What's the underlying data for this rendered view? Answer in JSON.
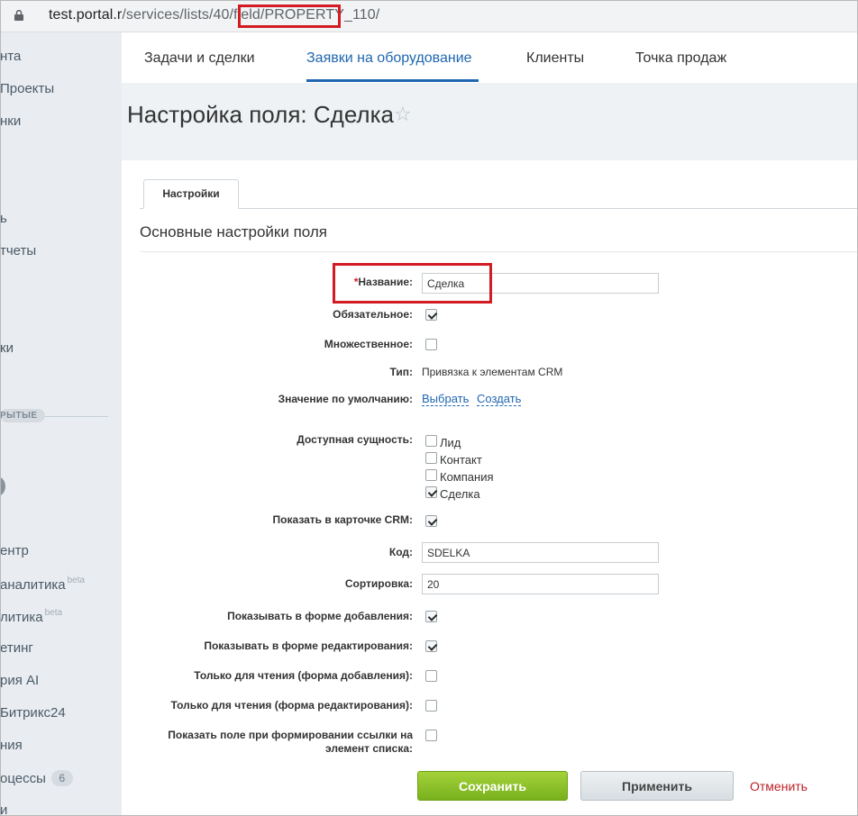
{
  "browser": {
    "url_host": "test.portal.r",
    "url_sep": "/",
    "url_path": "services/lists/40/field/",
    "url_highlight": "PROPERTY_110/"
  },
  "sidebar": {
    "items": [
      {
        "label": "нта"
      },
      {
        "label": "Проекты"
      },
      {
        "label": "нки"
      },
      {
        "label": "ь"
      },
      {
        "label": "тчеты"
      },
      {
        "label": "ки"
      },
      {
        "label": "ентр"
      },
      {
        "label": "аналитика",
        "sup": "beta"
      },
      {
        "label": "литика",
        "sup": "beta"
      },
      {
        "label": "етинг"
      },
      {
        "label": "рия AI"
      },
      {
        "label": "Битрикс24"
      },
      {
        "label": "ния"
      },
      {
        "label": "оцессы",
        "badge": "6"
      },
      {
        "label": "и"
      }
    ],
    "section_badge": "РЫТЫЕ"
  },
  "topnav": {
    "tabs": [
      {
        "label": "Задачи и сделки"
      },
      {
        "label": "Заявки на оборудование"
      },
      {
        "label": "Клиенты"
      },
      {
        "label": "Точка продаж"
      }
    ]
  },
  "page": {
    "title": "Настройка поля: Сделка",
    "star": "☆"
  },
  "form": {
    "tab_label": "Настройки",
    "section_title": "Основные настройки поля",
    "fields": {
      "name": {
        "required_mark": "*",
        "label": "Название:",
        "value": "Сделка"
      },
      "mandatory": {
        "label": "Обязательное:",
        "checked": true
      },
      "multiple": {
        "label": "Множественное:",
        "checked": false
      },
      "type": {
        "label": "Тип:",
        "value": "Привязка к элементам CRM"
      },
      "default_value": {
        "label": "Значение по умолчанию:",
        "link_select": "Выбрать",
        "link_create": "Создать"
      },
      "entities": {
        "label": "Доступная сущность:",
        "options": [
          {
            "label": "Лид",
            "checked": false
          },
          {
            "label": "Контакт",
            "checked": false
          },
          {
            "label": "Компания",
            "checked": false
          },
          {
            "label": "Сделка",
            "checked": true
          }
        ]
      },
      "show_in_crm": {
        "label": "Показать в карточке CRM:",
        "checked": true
      },
      "code": {
        "label": "Код:",
        "value": "SDELKA"
      },
      "sort": {
        "label": "Сортировка:",
        "value": "20"
      },
      "show_add": {
        "label": "Показывать в форме добавления:",
        "checked": true
      },
      "show_edit": {
        "label": "Показывать в форме редактирования:",
        "checked": true
      },
      "readonly_add": {
        "label": "Только для чтения (форма добавления):",
        "checked": false
      },
      "readonly_edit": {
        "label": "Только для чтения (форма редактирования):",
        "checked": false
      },
      "show_link": {
        "label_line1": "Показать поле при формировании ссылки на",
        "label_line2": "элемент списка:",
        "checked": false
      }
    },
    "buttons": {
      "save": "Сохранить",
      "apply": "Применить",
      "cancel": "Отменить"
    }
  },
  "colors": {
    "accent": "#2067b0",
    "highlight": "#d21b22",
    "save_button": "#8cc22a",
    "cancel_link": "#bc2127"
  }
}
